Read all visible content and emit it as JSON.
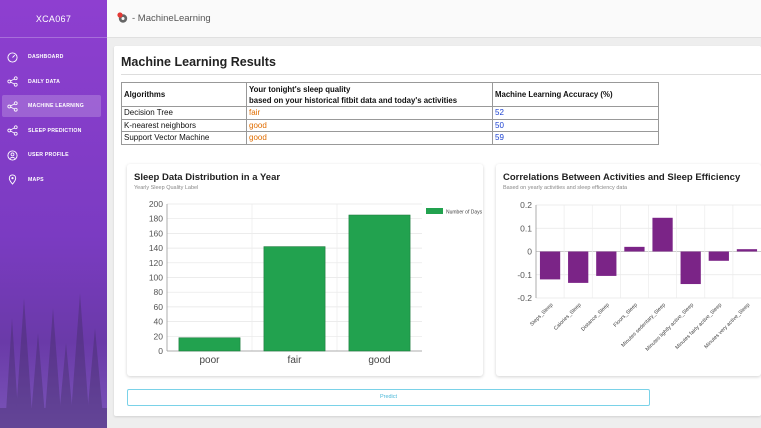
{
  "app": {
    "brand": "XCA067"
  },
  "sidebar": {
    "items": [
      {
        "label": "DASHBOARD",
        "icon": "dashboard-icon"
      },
      {
        "label": "DAILY DATA",
        "icon": "share-icon"
      },
      {
        "label": "MACHINE LEARNING",
        "icon": "share-icon",
        "active": true
      },
      {
        "label": "SLEEP PREDICTION",
        "icon": "share-icon"
      },
      {
        "label": "USER PROFILE",
        "icon": "user-icon"
      },
      {
        "label": "MAPS",
        "icon": "map-pin-icon"
      }
    ]
  },
  "header": {
    "breadcrumb": "- MachineLearning",
    "icon": "gear-icon"
  },
  "main": {
    "title": "Machine Learning Results",
    "table": {
      "headers": [
        "Algorithms",
        "Your tonight's sleep quality\nbased on your historical fitbit data and today's activities",
        "Machine Learning Accuracy (%)"
      ],
      "header_quality_line1": "Your tonight's sleep quality",
      "header_quality_line2": "based on your historical fitbit data and today's activities",
      "rows": [
        {
          "algorithm": "Decision Tree",
          "quality": "fair",
          "accuracy": "52"
        },
        {
          "algorithm": "K-nearest neighbors",
          "quality": "good",
          "accuracy": "50"
        },
        {
          "algorithm": "Support Vector Machine",
          "quality": "good",
          "accuracy": "59"
        }
      ]
    },
    "predict_label": "Predict"
  },
  "colors": {
    "bar_green": "#22a24f",
    "bar_purple": "#7b2487",
    "sidebar_purple": "#8e3fd0",
    "quality_orange": "#e06d00",
    "accuracy_blue": "#1a3fd0"
  },
  "chart_data": [
    {
      "type": "bar",
      "title": "Sleep Data Distribution in a Year",
      "subtitle": "Yearly Sleep Quality Label",
      "categories": [
        "poor",
        "fair",
        "good"
      ],
      "series": [
        {
          "name": "Number of Days",
          "values": [
            18,
            142,
            185
          ]
        }
      ],
      "ylim": [
        0,
        200
      ],
      "yticks": [
        0,
        20,
        40,
        60,
        80,
        100,
        120,
        140,
        160,
        180,
        200
      ],
      "grid": true,
      "legend": "top-right"
    },
    {
      "type": "bar",
      "title": "Correlations Between Activities and Sleep Efficiency",
      "subtitle": "Based on yearly activities and sleep efficiency data",
      "categories": [
        "Steps_Sleep",
        "Calories_Sleep",
        "Distance_Sleep",
        "Floors_Sleep",
        "Minutes sedentary_Sleep",
        "Minutes lightly active_Sleep",
        "Minutes fairly active_Sleep",
        "Minutes very active_Sleep"
      ],
      "values": [
        -0.12,
        -0.135,
        -0.105,
        0.02,
        0.145,
        -0.14,
        -0.04,
        0.01
      ],
      "ylim": [
        -0.2,
        0.2
      ],
      "yticks": [
        -0.2,
        -0.1,
        0,
        0.1,
        0.2
      ],
      "grid": true
    }
  ]
}
